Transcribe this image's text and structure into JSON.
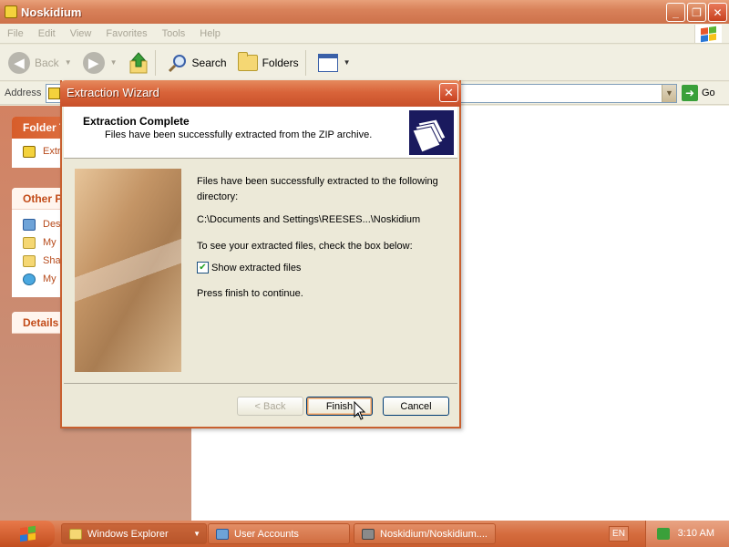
{
  "explorer": {
    "title": "Noskidium",
    "menu": [
      "File",
      "Edit",
      "View",
      "Favorites",
      "Tools",
      "Help"
    ],
    "toolbar": {
      "back": "Back",
      "search": "Search",
      "folders": "Folders"
    },
    "address": {
      "label": "Address",
      "go": "Go"
    },
    "sidebar": {
      "folder_tasks_title": "Folder T",
      "folder_tasks_item": "Extr",
      "other_places_title": "Other P",
      "other_places_items": [
        "Des",
        "My",
        "Sha",
        "My"
      ],
      "details_title": "Details"
    }
  },
  "dialog": {
    "title": "Extraction Wizard",
    "header_title": "Extraction Complete",
    "header_subtitle": "Files have been successfully extracted from the ZIP archive.",
    "line1": "Files have been successfully extracted to the following directory:",
    "path": "C:\\Documents and Settings\\REESES...\\Noskidium",
    "line2": "To see your extracted files, check the box below:",
    "checkbox_label": "Show extracted files",
    "checkbox_checked": true,
    "line3": "Press finish to continue.",
    "back_button": "< Back",
    "finish_button": "Finish",
    "cancel_button": "Cancel"
  },
  "taskbar": {
    "tasks": [
      "Windows Explorer",
      "User Accounts",
      "Noskidium/Noskidium...."
    ],
    "language": "EN",
    "clock": "3:10 AM"
  },
  "colors": {
    "title_accent": "#d9643a",
    "sidebar_link": "#b74b1c",
    "header_icon_bg": "#1a1a5e"
  }
}
